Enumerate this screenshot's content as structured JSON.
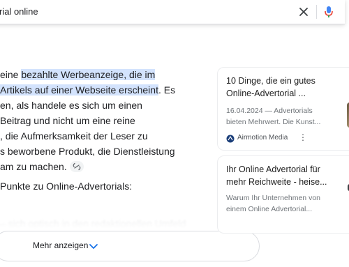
{
  "search": {
    "query": "rial online",
    "clear_icon": "close-icon",
    "mic_icon": "mic-icon"
  },
  "answer": {
    "line1_pre": "eine ",
    "line1_hl": "bezahlte Werbeanzeige, die im",
    "line2_hl": "Artikels auf einer Webseite erscheint",
    "line2_post": ". Es",
    "line3": "en, als handele es sich um einen",
    "line4": "Beitrag und nicht um eine reine",
    "line5": ", die Aufmerksamkeit der Leser zu",
    "line6": "s beworbene Produkt, die Dienstleistung",
    "line7": "am zu machen.",
    "points_heading": "Punkte zu Online-Advertorials:",
    "faded_line": "– sich optisch in den redaktionellen Umfeld"
  },
  "more_button": {
    "label": "Mehr anzeigen",
    "icon": "chevron-down-icon"
  },
  "cards": [
    {
      "title_line1": "10 Dinge, die ein gutes",
      "title_line2": "Online-Advertorial ...",
      "snippet_line1": "16.04.2024 — Advertorials",
      "snippet_line2": "bieten Mehrwert. Die Kunst...",
      "source": "Airmotion Media",
      "menu_icon": "more-vert-icon"
    },
    {
      "title_line1": "Ihr Online Advertorial für",
      "title_line2": "mehr Reichweite - heise...",
      "snippet_line1": "Warum Ihr Unternehmen von",
      "snippet_line2": "einem Online Advertorial..."
    }
  ]
}
